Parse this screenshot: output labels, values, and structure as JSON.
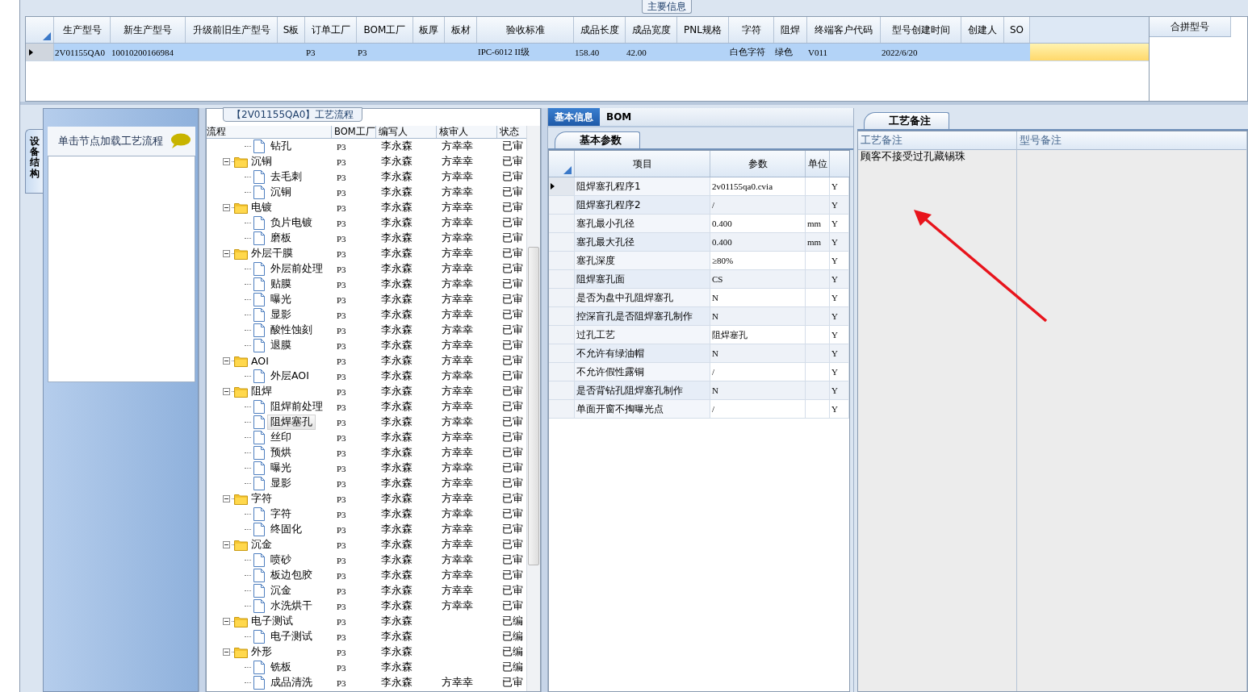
{
  "main_info": {
    "title": "主要信息",
    "columns": [
      "生产型号",
      "新生产型号",
      "升级前旧生产型号",
      "S板",
      "订单工厂",
      "BOM工厂",
      "板厚",
      "板材",
      "验收标准",
      "成品长度",
      "成品宽度",
      "PNL规格",
      "字符",
      "阻焊",
      "终端客户代码",
      "型号创建时间",
      "创建人",
      "SO"
    ],
    "rows": [
      {
        "selected": true,
        "cells": [
          "2V01155QA0",
          "10010200166984",
          "",
          "",
          "P3",
          "P3",
          "",
          "",
          "IPC-6012 II级",
          "158.40",
          "42.00",
          "",
          "白色字符",
          "绿色",
          "V011",
          "2022/6/20",
          "",
          ""
        ]
      }
    ],
    "merge_panel": {
      "title": "合拼型号"
    }
  },
  "side_tab": {
    "label": "设备结构"
  },
  "equipment_panel": {
    "title": "单击节点加载工艺流程"
  },
  "flow": {
    "title": "【2V01155QA0】工艺流程",
    "columns": [
      "流程",
      "BOM工厂",
      "编写人",
      "核审人",
      "状态"
    ],
    "tree": [
      {
        "children": [
          {
            "label": "钻孔",
            "bom": "P3",
            "writer": "李永森",
            "reviewer": "方幸幸",
            "status": "已审",
            "selected": false
          }
        ]
      },
      {
        "label": "沉铜",
        "bom": "P3",
        "writer": "李永森",
        "reviewer": "方幸幸",
        "status": "已审",
        "selected": false,
        "expanded": true,
        "children": [
          {
            "label": "去毛刺",
            "bom": "P3",
            "writer": "李永森",
            "reviewer": "方幸幸",
            "status": "已审",
            "selected": false
          },
          {
            "label": "沉铜",
            "bom": "P3",
            "writer": "李永森",
            "reviewer": "方幸幸",
            "status": "已审",
            "selected": false
          }
        ]
      },
      {
        "label": "电镀",
        "bom": "P3",
        "writer": "李永森",
        "reviewer": "方幸幸",
        "status": "已审",
        "selected": false,
        "expanded": true,
        "children": [
          {
            "label": "负片电镀",
            "bom": "P3",
            "writer": "李永森",
            "reviewer": "方幸幸",
            "status": "已审",
            "selected": false
          },
          {
            "label": "磨板",
            "bom": "P3",
            "writer": "李永森",
            "reviewer": "方幸幸",
            "status": "已审",
            "selected": false
          }
        ]
      },
      {
        "label": "外层干膜",
        "bom": "P3",
        "writer": "李永森",
        "reviewer": "方幸幸",
        "status": "已审",
        "selected": false,
        "expanded": true,
        "children": [
          {
            "label": "外层前处理",
            "bom": "P3",
            "writer": "李永森",
            "reviewer": "方幸幸",
            "status": "已审",
            "selected": false
          },
          {
            "label": "贴膜",
            "bom": "P3",
            "writer": "李永森",
            "reviewer": "方幸幸",
            "status": "已审",
            "selected": false
          },
          {
            "label": "曝光",
            "bom": "P3",
            "writer": "李永森",
            "reviewer": "方幸幸",
            "status": "已审",
            "selected": false
          },
          {
            "label": "显影",
            "bom": "P3",
            "writer": "李永森",
            "reviewer": "方幸幸",
            "status": "已审",
            "selected": false
          },
          {
            "label": "酸性蚀刻",
            "bom": "P3",
            "writer": "李永森",
            "reviewer": "方幸幸",
            "status": "已审",
            "selected": false
          },
          {
            "label": "退膜",
            "bom": "P3",
            "writer": "李永森",
            "reviewer": "方幸幸",
            "status": "已审",
            "selected": false
          }
        ]
      },
      {
        "label": "AOI",
        "bom": "P3",
        "writer": "李永森",
        "reviewer": "方幸幸",
        "status": "已审",
        "selected": false,
        "expanded": true,
        "children": [
          {
            "label": "外层AOI",
            "bom": "P3",
            "writer": "李永森",
            "reviewer": "方幸幸",
            "status": "已审",
            "selected": false
          }
        ]
      },
      {
        "label": "阻焊",
        "bom": "P3",
        "writer": "李永森",
        "reviewer": "方幸幸",
        "status": "已审",
        "selected": false,
        "expanded": true,
        "children": [
          {
            "label": "阻焊前处理",
            "bom": "P3",
            "writer": "李永森",
            "reviewer": "方幸幸",
            "status": "已审",
            "selected": false
          },
          {
            "label": "阻焊塞孔",
            "bom": "P3",
            "writer": "李永森",
            "reviewer": "方幸幸",
            "status": "已审",
            "selected": true
          },
          {
            "label": "丝印",
            "bom": "P3",
            "writer": "李永森",
            "reviewer": "方幸幸",
            "status": "已审",
            "selected": false
          },
          {
            "label": "预烘",
            "bom": "P3",
            "writer": "李永森",
            "reviewer": "方幸幸",
            "status": "已审",
            "selected": false
          },
          {
            "label": "曝光",
            "bom": "P3",
            "writer": "李永森",
            "reviewer": "方幸幸",
            "status": "已审",
            "selected": false
          },
          {
            "label": "显影",
            "bom": "P3",
            "writer": "李永森",
            "reviewer": "方幸幸",
            "status": "已审",
            "selected": false
          }
        ]
      },
      {
        "label": "字符",
        "bom": "P3",
        "writer": "李永森",
        "reviewer": "方幸幸",
        "status": "已审",
        "selected": false,
        "expanded": true,
        "children": [
          {
            "label": "字符",
            "bom": "P3",
            "writer": "李永森",
            "reviewer": "方幸幸",
            "status": "已审",
            "selected": false
          },
          {
            "label": "终固化",
            "bom": "P3",
            "writer": "李永森",
            "reviewer": "方幸幸",
            "status": "已审",
            "selected": false
          }
        ]
      },
      {
        "label": "沉金",
        "bom": "P3",
        "writer": "李永森",
        "reviewer": "方幸幸",
        "status": "已审",
        "selected": false,
        "expanded": true,
        "children": [
          {
            "label": "喷砂",
            "bom": "P3",
            "writer": "李永森",
            "reviewer": "方幸幸",
            "status": "已审",
            "selected": false
          },
          {
            "label": "板边包胶",
            "bom": "P3",
            "writer": "李永森",
            "reviewer": "方幸幸",
            "status": "已审",
            "selected": false
          },
          {
            "label": "沉金",
            "bom": "P3",
            "writer": "李永森",
            "reviewer": "方幸幸",
            "status": "已审",
            "selected": false
          },
          {
            "label": "水洗烘干",
            "bom": "P3",
            "writer": "李永森",
            "reviewer": "方幸幸",
            "status": "已审",
            "selected": false
          }
        ]
      },
      {
        "label": "电子测试",
        "bom": "P3",
        "writer": "李永森",
        "status": "已编",
        "selected": false,
        "expanded": true,
        "children": [
          {
            "label": "电子测试",
            "bom": "P3",
            "writer": "李永森",
            "status": "已编",
            "selected": false
          }
        ]
      },
      {
        "label": "外形",
        "bom": "P3",
        "writer": "李永森",
        "status": "已编",
        "selected": false,
        "expanded": true,
        "children": [
          {
            "label": "铣板",
            "bom": "P3",
            "writer": "李永森",
            "status": "已编",
            "selected": false
          },
          {
            "label": "成品清洗",
            "bom": "P3",
            "writer": "李永森",
            "reviewer": "方幸幸",
            "status": "已审",
            "selected": false
          }
        ]
      }
    ]
  },
  "detail": {
    "tabs": [
      {
        "label": "基本信息",
        "selected": true
      },
      {
        "label": "BOM",
        "selected": false
      }
    ],
    "sub_tab": {
      "label": "基本参数"
    },
    "columns": [
      "项目",
      "参数",
      "单位"
    ],
    "rows": [
      {
        "item": "阻焊塞孔程序1",
        "value": "2v01155qa0.cvia",
        "flag": "Y",
        "selected": true
      },
      {
        "item": "阻焊塞孔程序2",
        "value": "/",
        "flag": "Y",
        "selected": false
      },
      {
        "item": "塞孔最小孔径",
        "value": "0.400",
        "unit": "mm",
        "flag": "Y",
        "selected": false
      },
      {
        "item": "塞孔最大孔径",
        "value": "0.400",
        "unit": "mm",
        "flag": "Y",
        "selected": false
      },
      {
        "item": "塞孔深度",
        "value": "≥80%",
        "flag": "Y",
        "selected": false
      },
      {
        "item": "阻焊塞孔面",
        "value": "CS",
        "flag": "Y",
        "selected": false
      },
      {
        "item": "是否为盘中孔阻焊塞孔",
        "value": "N",
        "flag": "Y",
        "selected": false
      },
      {
        "item": "控深盲孔是否阻焊塞孔制作",
        "value": "N",
        "flag": "Y",
        "selected": false
      },
      {
        "item": "过孔工艺",
        "value": "阻焊塞孔",
        "flag": "Y",
        "selected": false
      },
      {
        "item": "不允许有绿油帽",
        "value": "N",
        "flag": "Y",
        "selected": false
      },
      {
        "item": "不允许假性露铜",
        "value": "/",
        "flag": "Y",
        "selected": false
      },
      {
        "item": "是否背钻孔阻焊塞孔制作",
        "value": "N",
        "flag": "Y",
        "selected": false
      },
      {
        "item": "单面开窗不掏曝光点",
        "value": "/",
        "flag": "Y",
        "selected": false
      }
    ]
  },
  "notes": {
    "tab": {
      "label": "工艺备注"
    },
    "columns": [
      "工艺备注",
      "型号备注"
    ],
    "rows": [
      {
        "process_note": "顾客不接受过孔藏锡珠"
      }
    ]
  }
}
